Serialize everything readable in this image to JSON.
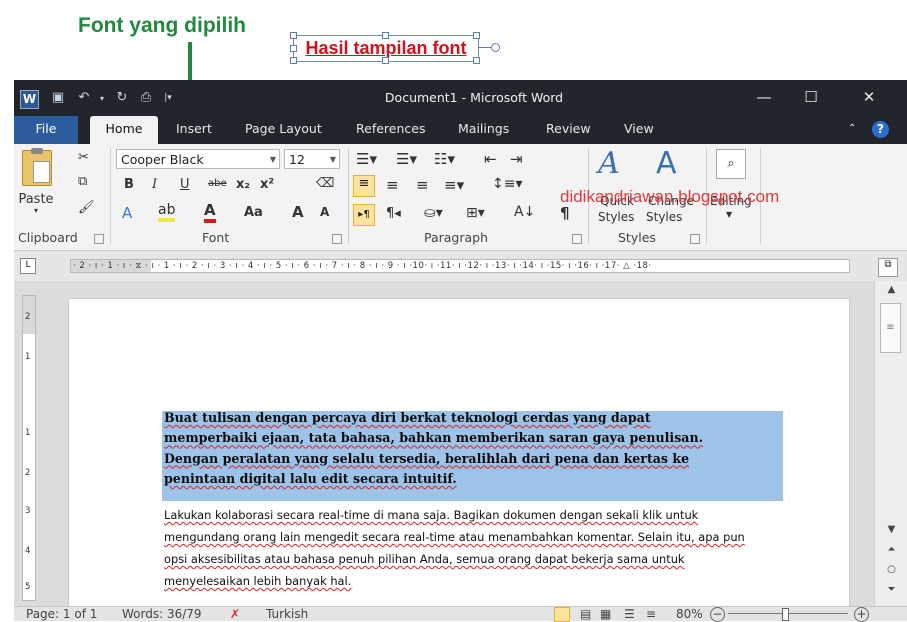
{
  "annotations": {
    "font_selected": "Font yang dipilih",
    "result_display": "Hasil tampilan font"
  },
  "window": {
    "title": "Document1 - Microsoft Word",
    "controls": {
      "minimize": "—",
      "maximize": "☐",
      "close": "✕"
    }
  },
  "tabs": [
    "File",
    "Home",
    "Insert",
    "Page Layout",
    "References",
    "Mailings",
    "Review",
    "View"
  ],
  "active_tab": "Home",
  "ribbon": {
    "clipboard": {
      "paste_label": "Paste",
      "group_label": "Clipboard"
    },
    "font": {
      "font_name": "Cooper Black",
      "font_size": "12",
      "group_label": "Font",
      "bold": "B",
      "italic": "I",
      "underline": "U",
      "strike": "abe",
      "subscript": "x₂",
      "superscript": "x²",
      "change_case": "Aa",
      "grow": "A",
      "shrink": "A"
    },
    "paragraph": {
      "group_label": "Paragraph",
      "pilcrow": "¶"
    },
    "styles": {
      "quick_styles": "Quick",
      "quick_styles_2": "Styles",
      "change_styles": "Change",
      "change_styles_2": "Styles",
      "group_label": "Styles"
    },
    "editing": {
      "label": "Editing"
    }
  },
  "watermark_text": "didikandriawan.blogspot.com",
  "ruler": {
    "horizontal": "· 2 · ı · 1 · ı · ⧖ · ı · 1 · ı · 2 · ı · 3 · ı · 4 · ı · 5 · ı · 6 · ı · 7 · ı · 8 · ı · 9 · ı ·10· ı ·11· ı ·12· ı ·13· ı ·14· ı ·15· ı ·16· ı ·17· △ ·18·",
    "vertical": [
      "2",
      "1",
      "1",
      "2",
      "3",
      "4",
      "5"
    ]
  },
  "document": {
    "heading_lines": [
      "Buat tulisan dengan percaya diri berkat teknologi cerdas yang dapat",
      "memperbaiki ejaan, tata bahasa, bahkan memberikan saran gaya penulisan.",
      "Dengan peralatan yang selalu tersedia, beralihlah dari pena dan  kertas ke",
      "penintaan digital lalu edit secara intuitif."
    ],
    "body_lines": [
      "Lakukan kolaborasi secara real-time di mana saja. Bagikan dokumen dengan sekali klik untuk",
      "mengundang orang lain mengedit secara real-time atau menambahkan komentar. Selain itu, apa pun",
      "opsi aksesibilitas atau bahasa penuh pilihan Anda, semua orang dapat bekerja sama untuk",
      "menyelesaikan lebih banyak hal."
    ]
  },
  "status": {
    "page": "Page: 1 of 1",
    "words": "Words: 36/79",
    "language": "Turkish",
    "zoom": "80%"
  }
}
